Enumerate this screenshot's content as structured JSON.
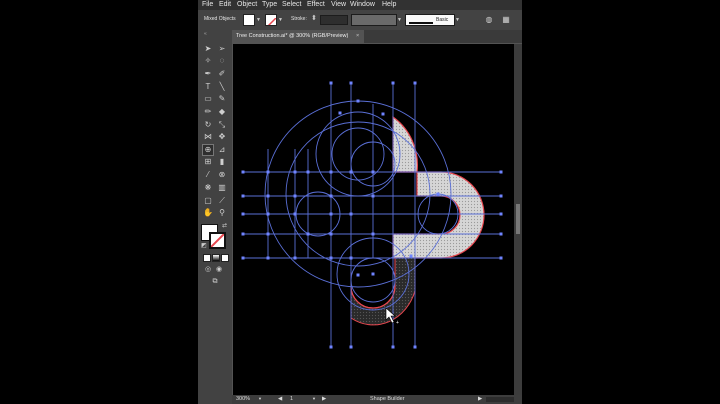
{
  "menu": [
    "File",
    "Edit",
    "Object",
    "Type",
    "Select",
    "Effect",
    "View",
    "Window",
    "Help"
  ],
  "control_bar": {
    "selection_label": "Mixed Objects",
    "stroke_label": "Stroke:",
    "brush_label": "Basic"
  },
  "document_tab": {
    "title": "Tree Construction.ai* @ 300% (RGB/Preview)",
    "close": "×"
  },
  "tools": [
    "selection",
    "direct-selection",
    "magic-wand",
    "lasso",
    "pen",
    "curvature",
    "type",
    "line",
    "rectangle",
    "paintbrush",
    "pencil",
    "eraser",
    "rotate",
    "scale",
    "width",
    "free-transform",
    "shape-builder",
    "perspective-grid",
    "mesh",
    "gradient",
    "eyedropper",
    "blend",
    "symbol-sprayer",
    "column-graph",
    "artboard",
    "slice",
    "hand",
    "zoom"
  ],
  "colors": {
    "accent_stroke": "#e8474f",
    "guide_blue": "#5a6fd6",
    "fill_grey": "#d8d8d8",
    "fill_dark": "#333333"
  },
  "status_bar": {
    "zoom": "300%",
    "page": "1",
    "tool_name": "Shape Builder"
  }
}
